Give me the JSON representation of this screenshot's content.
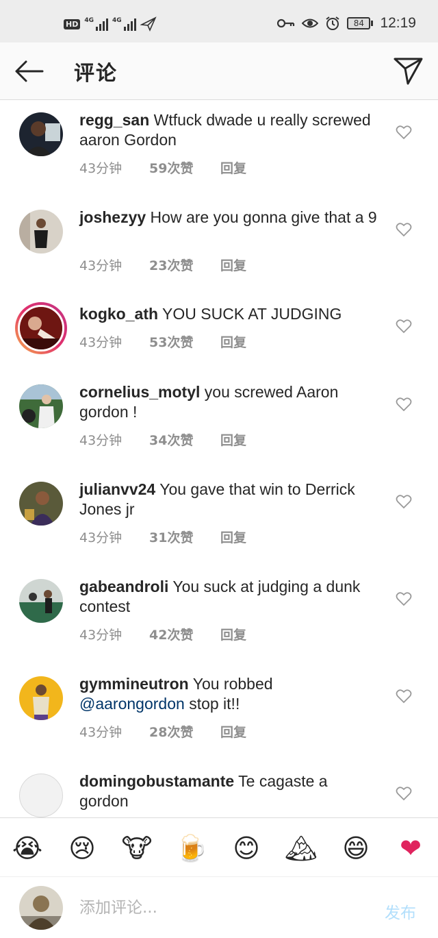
{
  "status_bar": {
    "hd_label": "HD",
    "network_1": "4G",
    "network_2": "4G",
    "battery": "84",
    "time": "12:19"
  },
  "header": {
    "title": "评论",
    "back_icon": "arrow-left-icon",
    "share_icon": "paper-plane-icon"
  },
  "comments": [
    {
      "username": "regg_san",
      "text": "Wtfuck dwade u really screwed aaron Gordon",
      "time": "43分钟",
      "likes": "59次赞",
      "reply": "回复"
    },
    {
      "username": "joshezyy",
      "text": "How are you gonna give that a 9",
      "time": "43分钟",
      "likes": "23次赞",
      "reply": "回复"
    },
    {
      "username": "kogko_ath",
      "text": "YOU SUCK AT JUDGING",
      "time": "43分钟",
      "likes": "53次赞",
      "reply": "回复"
    },
    {
      "username": "cornelius_motyl",
      "text": "you screwed Aaron gordon !",
      "time": "43分钟",
      "likes": "34次赞",
      "reply": "回复"
    },
    {
      "username": "julianvv24",
      "text": "You gave that win to Derrick Jones jr",
      "time": "43分钟",
      "likes": "31次赞",
      "reply": "回复"
    },
    {
      "username": "gabeandroli",
      "text": "You suck at judging a dunk contest",
      "time": "43分钟",
      "likes": "42次赞",
      "reply": "回复"
    },
    {
      "username": "gymmineutron",
      "text": "You robbed",
      "mention": "@aarongordon",
      "text_after": "stop it!!",
      "time": "43分钟",
      "likes": "28次赞",
      "reply": "回复"
    },
    {
      "username": "domingobustamante",
      "text": "Te cagaste a gordon"
    }
  ],
  "emojis": [
    "😭",
    "😢",
    "🐮",
    "🍺",
    "😊",
    "🏔",
    "😄",
    "❤"
  ],
  "emoji_names": [
    "loudly-crying-face-icon",
    "crying-face-icon",
    "cow-face-icon",
    "beer-mug-icon",
    "smiling-face-icon",
    "mountain-icon",
    "grinning-face-icon",
    "red-heart-icon"
  ],
  "input": {
    "placeholder": "添加评论...",
    "post_label": "发布"
  },
  "colors": {
    "text": "#262626",
    "meta": "#8e8e8e",
    "mention": "#003569",
    "post_disabled": "#b2dffc",
    "heart_outline": "#999999",
    "status_bar_bg": "#ededed"
  }
}
